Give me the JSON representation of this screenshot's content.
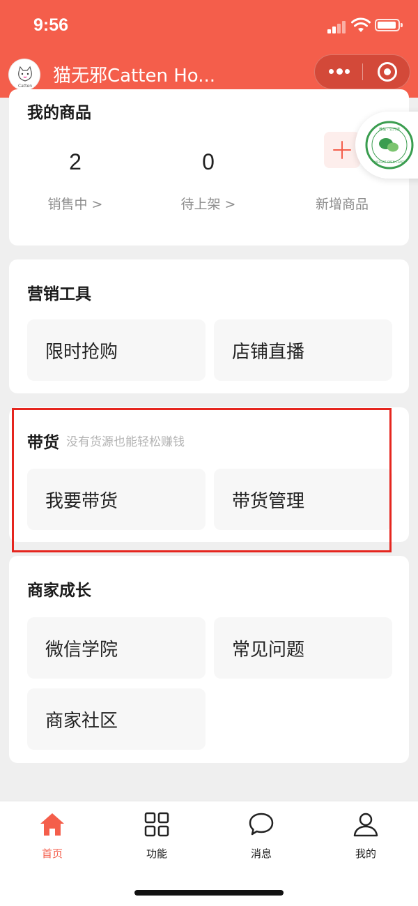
{
  "status_bar": {
    "time": "9:56"
  },
  "header": {
    "title": "猫无邪Catten Ho...",
    "avatar_caption": "Catten"
  },
  "my_products": {
    "title": "我的商品",
    "stats": [
      {
        "value": "2",
        "label": "销售中 >"
      },
      {
        "value": "0",
        "label": "待上架 >"
      }
    ],
    "add_label": "新增商品"
  },
  "badge": {
    "top_text": "微信 · 公开课",
    "bottom_text": "WECHAT OPEN CLASS"
  },
  "marketing": {
    "title": "营销工具",
    "tiles": [
      "限时抢购",
      "店铺直播"
    ]
  },
  "selling": {
    "title": "带货",
    "subtitle": "没有货源也能轻松赚钱",
    "tiles": [
      "我要带货",
      "带货管理"
    ]
  },
  "growth": {
    "title": "商家成长",
    "tiles": [
      "微信学院",
      "常见问题",
      "商家社区"
    ]
  },
  "tabbar": {
    "items": [
      {
        "label": "首页",
        "icon": "home-icon",
        "active": true
      },
      {
        "label": "功能",
        "icon": "grid-icon",
        "active": false
      },
      {
        "label": "消息",
        "icon": "chat-bubble-icon",
        "active": false
      },
      {
        "label": "我的",
        "icon": "user-icon",
        "active": false
      }
    ]
  },
  "colors": {
    "brand": "#f45e4b",
    "highlight": "#e5251e",
    "background": "#efefef"
  }
}
